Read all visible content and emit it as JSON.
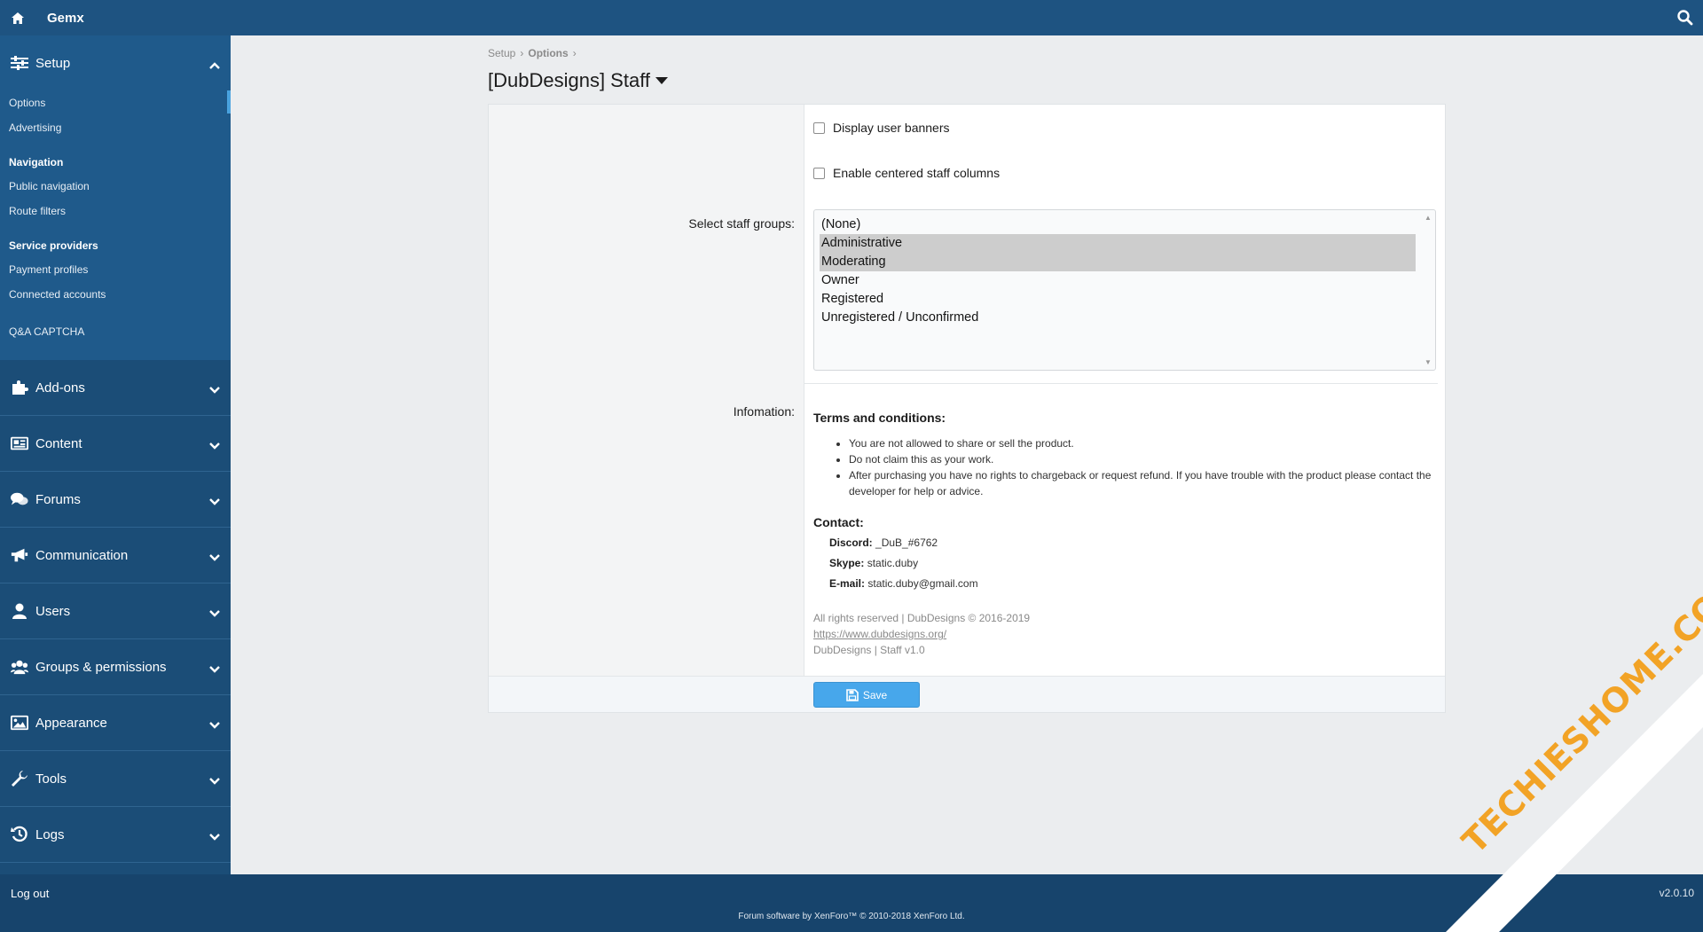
{
  "topbar": {
    "title": "Gemx"
  },
  "sidebar": {
    "setup": {
      "label": "Setup",
      "items": [
        {
          "label": "Options",
          "active": true
        },
        {
          "label": "Advertising"
        }
      ],
      "navigation_heading": "Navigation",
      "navigation_items": [
        "Public navigation",
        "Route filters"
      ],
      "service_heading": "Service providers",
      "service_items": [
        "Payment profiles",
        "Connected accounts"
      ],
      "qa_label": "Q&A CAPTCHA"
    },
    "sections": [
      {
        "label": "Add-ons",
        "icon": "puzzle-icon"
      },
      {
        "label": "Content",
        "icon": "newspaper-icon"
      },
      {
        "label": "Forums",
        "icon": "comments-icon"
      },
      {
        "label": "Communication",
        "icon": "bullhorn-icon"
      },
      {
        "label": "Users",
        "icon": "user-icon"
      },
      {
        "label": "Groups & permissions",
        "icon": "users-icon"
      },
      {
        "label": "Appearance",
        "icon": "image-icon"
      },
      {
        "label": "Tools",
        "icon": "wrench-icon"
      },
      {
        "label": "Logs",
        "icon": "history-icon"
      }
    ]
  },
  "breadcrumb": {
    "first": "Setup",
    "second": "Options"
  },
  "page": {
    "title": "[DubDesigns] Staff"
  },
  "form": {
    "display_user_banners": "Display user banners",
    "enable_centered": "Enable centered staff columns",
    "select_staff_label": "Select staff groups:",
    "staff_options": [
      {
        "label": "(None)",
        "selected": false
      },
      {
        "label": "Administrative",
        "selected": true
      },
      {
        "label": "Moderating",
        "selected": true
      },
      {
        "label": "Owner",
        "selected": false
      },
      {
        "label": "Registered",
        "selected": false
      },
      {
        "label": "Unregistered / Unconfirmed",
        "selected": false
      }
    ],
    "information_label": "Infomation:",
    "terms_heading": "Terms and conditions:",
    "terms": [
      "You are not allowed to share or sell the product.",
      "Do not claim this as your work.",
      "After purchasing you have no rights to chargeback or request refund. If you have trouble with the product please contact the developer for help or advice."
    ],
    "contact_heading": "Contact:",
    "contact": {
      "discord_label": "Discord:",
      "discord_value": "_DuB_#6762",
      "skype_label": "Skype:",
      "skype_value": "static.duby",
      "email_label": "E-mail:",
      "email_value": "static.duby@gmail.com"
    },
    "copyright": "All rights reserved | DubDesigns © 2016-2019",
    "link": "https://www.dubdesigns.org/",
    "version_line": "DubDesigns | Staff v1.0",
    "save_label": "Save"
  },
  "footer": {
    "logout": "Log out",
    "version": "v2.0.10",
    "credit": "Forum software by XenForo™ © 2010-2018 XenForo Ltd."
  },
  "watermark": {
    "text": "TECHIESHOME.COM"
  },
  "colors": {
    "topbar": "#1e5381",
    "sidebar": "#1b4d77",
    "accent": "#47a7eb",
    "watermark": "#f2a326"
  }
}
